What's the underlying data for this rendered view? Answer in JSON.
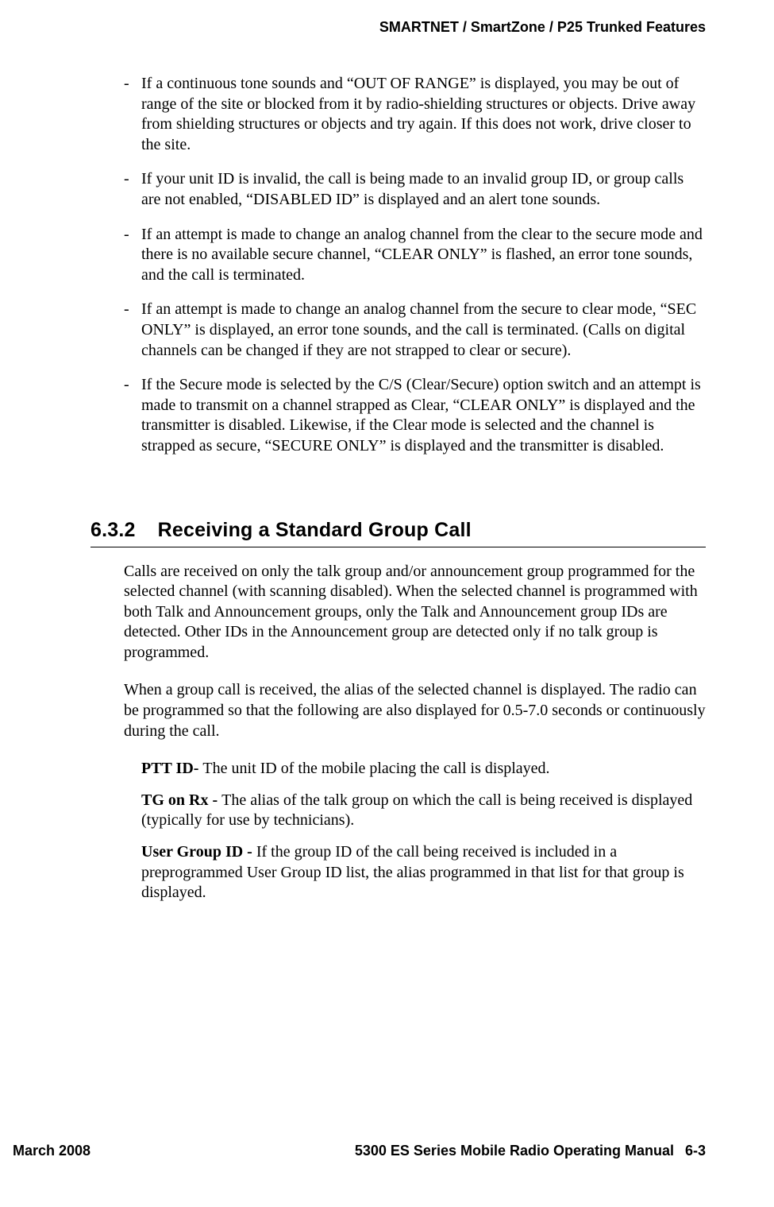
{
  "header": {
    "title": "SMARTNET / SmartZone / P25 Trunked Features"
  },
  "bullets": [
    "If a continuous tone sounds and “OUT OF RANGE” is displayed, you may be out of range of the site or blocked from it by radio-shielding structures or objects. Drive away from shielding structures or objects and try again. If this does not work, drive closer to the site.",
    "If your unit ID is invalid, the call is being made to an invalid group ID, or group calls are not enabled, “DISABLED ID” is displayed and an alert tone sounds.",
    "If an attempt is made to change an analog channel from the clear to the secure mode and there is no available secure channel, “CLEAR ONLY” is flashed, an error tone sounds, and the call is terminated.",
    "If an attempt is made to change an analog channel from the secure to clear mode, “SEC ONLY” is displayed, an error tone sounds, and the call is terminated. (Calls on digital channels can be changed if they are not strapped to clear or secure).",
    "If the Secure mode is selected by the C/S (Clear/Secure) option switch and an attempt is made to transmit on a channel strapped as Clear, “CLEAR ONLY” is displayed and the transmitter is disabled. Likewise, if the Clear mode is selected and the channel is strapped as secure, “SECURE ONLY” is displayed and the transmitter is disabled."
  ],
  "section": {
    "number": "6.3.2",
    "title": "Receiving a Standard Group Call"
  },
  "paragraphs": [
    "Calls are received on only the talk group and/or announcement group programmed for the selected channel (with scanning disabled). When the selected channel is programmed with both Talk and Announcement groups, only the Talk and Announcement group IDs are detected. Other IDs in the Announcement group are detected only if no talk group is programmed.",
    "When a group call is received, the alias of the selected channel is displayed. The radio can be programmed so that the following are also displayed for 0.5-7.0 seconds or continuously during the call."
  ],
  "definitions": [
    {
      "term": "PTT ID- ",
      "desc": "The unit ID of the mobile placing the call is displayed."
    },
    {
      "term": "TG on Rx - ",
      "desc": "The alias of the talk group on which the call is being received is displayed (typically for use by technicians)."
    },
    {
      "term": "User Group ID - ",
      "desc": "If the group ID of the call being received is included in a preprogrammed User Group ID list, the alias programmed in that list for that group is displayed."
    }
  ],
  "footer": {
    "date": "March 2008",
    "manual": "5300 ES Series Mobile Radio Operating Manual",
    "page": "6-3"
  }
}
